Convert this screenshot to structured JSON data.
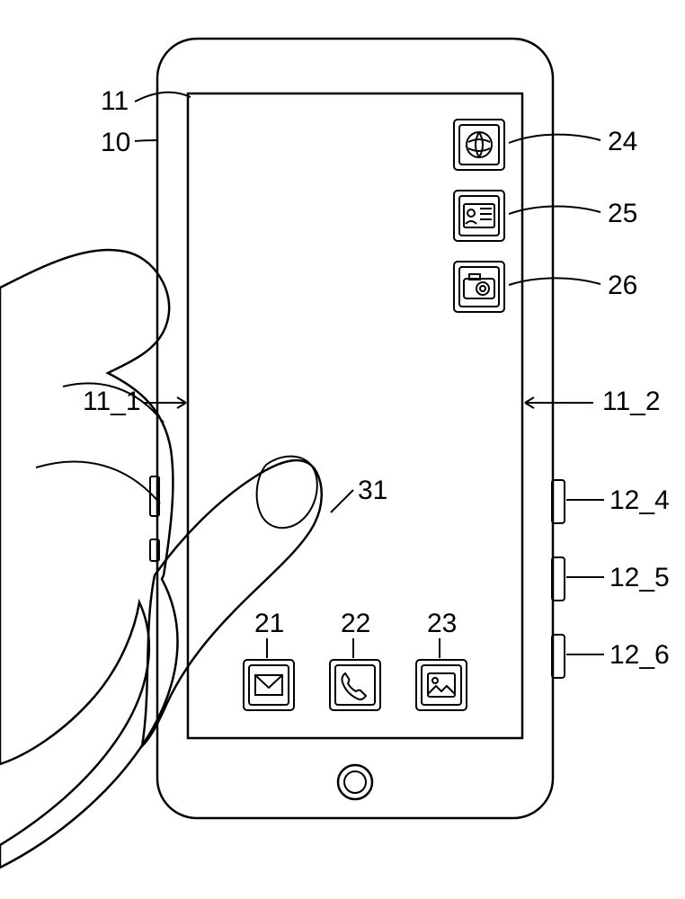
{
  "labels": {
    "11": "11",
    "10": "10",
    "11_1": "11_1",
    "11_2": "11_2",
    "24": "24",
    "25": "25",
    "26": "26",
    "12_4": "12_4",
    "12_5": "12_5",
    "12_6": "12_6",
    "21": "21",
    "22": "22",
    "23": "23",
    "31": "31"
  },
  "parts": {
    "10": "device-body",
    "11": "screen",
    "11_1": "screen-left-edge",
    "11_2": "screen-right-edge",
    "12_4": "side-key-4",
    "12_5": "side-key-5",
    "12_6": "side-key-6",
    "21": "app-icon-mail",
    "22": "app-icon-phone",
    "23": "app-icon-gallery",
    "24": "app-icon-globe",
    "25": "app-icon-contact-card",
    "26": "app-icon-camera",
    "31": "thumb"
  }
}
